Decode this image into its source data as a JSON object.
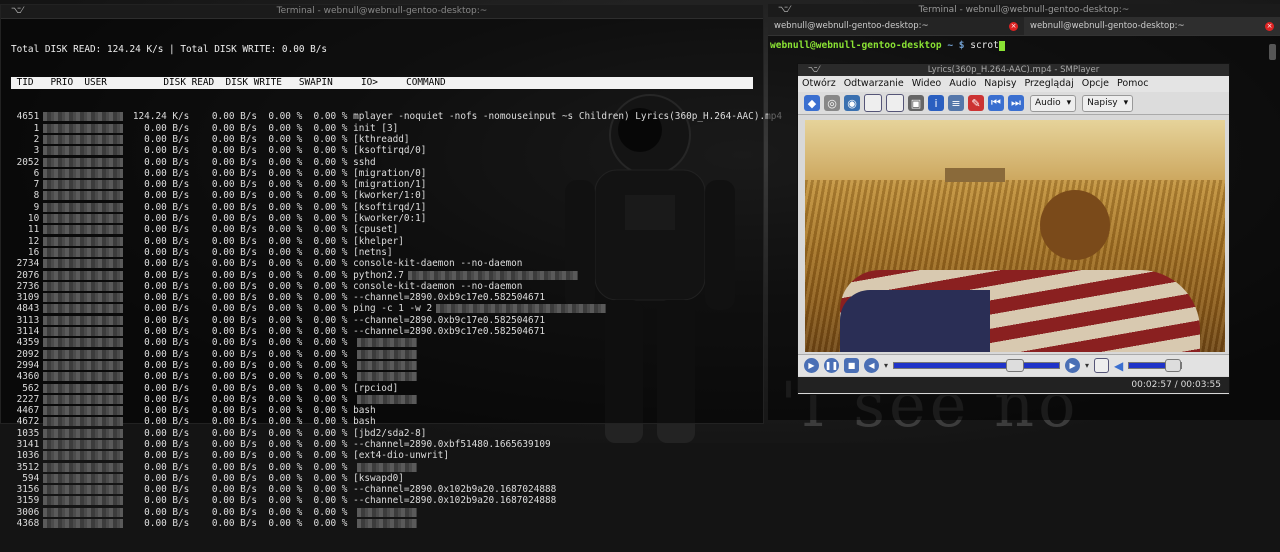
{
  "left_terminal": {
    "title": "Terminal - webnull@webnull-gentoo-desktop:~",
    "summary": "Total DISK READ: 124.24 K/s | Total DISK WRITE: 0.00 B/s",
    "columns": [
      " TID",
      "PRIO",
      "USER",
      "DISK READ",
      "DISK WRITE",
      "SWAPIN",
      "IO>",
      "COMMAND"
    ],
    "rows": [
      {
        "tid": "4651",
        "read": "124.24 K/s",
        "write": "0.00 B/s",
        "swap": "0.00 %",
        "io": "0.00 %",
        "cmd": "mplayer -noquiet -nofs -nomouseinput ~s Children) Lyrics(360p_H.264-AAC).mp4"
      },
      {
        "tid": "1",
        "read": "0.00 B/s",
        "write": "0.00 B/s",
        "swap": "0.00 %",
        "io": "0.00 %",
        "cmd": "init [3]"
      },
      {
        "tid": "2",
        "read": "0.00 B/s",
        "write": "0.00 B/s",
        "swap": "0.00 %",
        "io": "0.00 %",
        "cmd": "[kthreadd]"
      },
      {
        "tid": "3",
        "read": "0.00 B/s",
        "write": "0.00 B/s",
        "swap": "0.00 %",
        "io": "0.00 %",
        "cmd": "[ksoftirqd/0]"
      },
      {
        "tid": "2052",
        "read": "0.00 B/s",
        "write": "0.00 B/s",
        "swap": "0.00 %",
        "io": "0.00 %",
        "cmd": "sshd"
      },
      {
        "tid": "6",
        "read": "0.00 B/s",
        "write": "0.00 B/s",
        "swap": "0.00 %",
        "io": "0.00 %",
        "cmd": "[migration/0]"
      },
      {
        "tid": "7",
        "read": "0.00 B/s",
        "write": "0.00 B/s",
        "swap": "0.00 %",
        "io": "0.00 %",
        "cmd": "[migration/1]"
      },
      {
        "tid": "8",
        "read": "0.00 B/s",
        "write": "0.00 B/s",
        "swap": "0.00 %",
        "io": "0.00 %",
        "cmd": "[kworker/1:0]"
      },
      {
        "tid": "9",
        "read": "0.00 B/s",
        "write": "0.00 B/s",
        "swap": "0.00 %",
        "io": "0.00 %",
        "cmd": "[ksoftirqd/1]"
      },
      {
        "tid": "10",
        "read": "0.00 B/s",
        "write": "0.00 B/s",
        "swap": "0.00 %",
        "io": "0.00 %",
        "cmd": "[kworker/0:1]"
      },
      {
        "tid": "11",
        "read": "0.00 B/s",
        "write": "0.00 B/s",
        "swap": "0.00 %",
        "io": "0.00 %",
        "cmd": "[cpuset]"
      },
      {
        "tid": "12",
        "read": "0.00 B/s",
        "write": "0.00 B/s",
        "swap": "0.00 %",
        "io": "0.00 %",
        "cmd": "[khelper]"
      },
      {
        "tid": "16",
        "read": "0.00 B/s",
        "write": "0.00 B/s",
        "swap": "0.00 %",
        "io": "0.00 %",
        "cmd": "[netns]"
      },
      {
        "tid": "2734",
        "read": "0.00 B/s",
        "write": "0.00 B/s",
        "swap": "0.00 %",
        "io": "0.00 %",
        "cmd": "console-kit-daemon --no-daemon"
      },
      {
        "tid": "2076",
        "read": "0.00 B/s",
        "write": "0.00 B/s",
        "swap": "0.00 %",
        "io": "0.00 %",
        "cmd": "python2.7"
      },
      {
        "tid": "2736",
        "read": "0.00 B/s",
        "write": "0.00 B/s",
        "swap": "0.00 %",
        "io": "0.00 %",
        "cmd": "console-kit-daemon --no-daemon"
      },
      {
        "tid": "3109",
        "read": "0.00 B/s",
        "write": "0.00 B/s",
        "swap": "0.00 %",
        "io": "0.00 %",
        "cmd": "--channel=2890.0xb9c17e0.582504671"
      },
      {
        "tid": "4843",
        "read": "0.00 B/s",
        "write": "0.00 B/s",
        "swap": "0.00 %",
        "io": "0.00 %",
        "cmd": "ping -c 1 -w 2"
      },
      {
        "tid": "3113",
        "read": "0.00 B/s",
        "write": "0.00 B/s",
        "swap": "0.00 %",
        "io": "0.00 %",
        "cmd": "--channel=2890.0xb9c17e0.582504671"
      },
      {
        "tid": "3114",
        "read": "0.00 B/s",
        "write": "0.00 B/s",
        "swap": "0.00 %",
        "io": "0.00 %",
        "cmd": "--channel=2890.0xb9c17e0.582504671"
      },
      {
        "tid": "4359",
        "read": "0.00 B/s",
        "write": "0.00 B/s",
        "swap": "0.00 %",
        "io": "0.00 %",
        "cmd": ""
      },
      {
        "tid": "2092",
        "read": "0.00 B/s",
        "write": "0.00 B/s",
        "swap": "0.00 %",
        "io": "0.00 %",
        "cmd": ""
      },
      {
        "tid": "2994",
        "read": "0.00 B/s",
        "write": "0.00 B/s",
        "swap": "0.00 %",
        "io": "0.00 %",
        "cmd": ""
      },
      {
        "tid": "4360",
        "read": "0.00 B/s",
        "write": "0.00 B/s",
        "swap": "0.00 %",
        "io": "0.00 %",
        "cmd": ""
      },
      {
        "tid": "562",
        "read": "0.00 B/s",
        "write": "0.00 B/s",
        "swap": "0.00 %",
        "io": "0.00 %",
        "cmd": "[rpciod]"
      },
      {
        "tid": "2227",
        "read": "0.00 B/s",
        "write": "0.00 B/s",
        "swap": "0.00 %",
        "io": "0.00 %",
        "cmd": ""
      },
      {
        "tid": "4467",
        "read": "0.00 B/s",
        "write": "0.00 B/s",
        "swap": "0.00 %",
        "io": "0.00 %",
        "cmd": "bash"
      },
      {
        "tid": "4672",
        "read": "0.00 B/s",
        "write": "0.00 B/s",
        "swap": "0.00 %",
        "io": "0.00 %",
        "cmd": "bash"
      },
      {
        "tid": "1035",
        "read": "0.00 B/s",
        "write": "0.00 B/s",
        "swap": "0.00 %",
        "io": "0.00 %",
        "cmd": "[jbd2/sda2-8]"
      },
      {
        "tid": "3141",
        "read": "0.00 B/s",
        "write": "0.00 B/s",
        "swap": "0.00 %",
        "io": "0.00 %",
        "cmd": "--channel=2890.0xbf51480.1665639109"
      },
      {
        "tid": "1036",
        "read": "0.00 B/s",
        "write": "0.00 B/s",
        "swap": "0.00 %",
        "io": "0.00 %",
        "cmd": "[ext4-dio-unwrit]"
      },
      {
        "tid": "3512",
        "read": "0.00 B/s",
        "write": "0.00 B/s",
        "swap": "0.00 %",
        "io": "0.00 %",
        "cmd": ""
      },
      {
        "tid": "594",
        "read": "0.00 B/s",
        "write": "0.00 B/s",
        "swap": "0.00 %",
        "io": "0.00 %",
        "cmd": "[kswapd0]"
      },
      {
        "tid": "3156",
        "read": "0.00 B/s",
        "write": "0.00 B/s",
        "swap": "0.00 %",
        "io": "0.00 %",
        "cmd": "--channel=2890.0x102b9a20.1687024888"
      },
      {
        "tid": "3159",
        "read": "0.00 B/s",
        "write": "0.00 B/s",
        "swap": "0.00 %",
        "io": "0.00 %",
        "cmd": "--channel=2890.0x102b9a20.1687024888"
      },
      {
        "tid": "3006",
        "read": "0.00 B/s",
        "write": "0.00 B/s",
        "swap": "0.00 %",
        "io": "0.00 %",
        "cmd": ""
      },
      {
        "tid": "4368",
        "read": "0.00 B/s",
        "write": "0.00 B/s",
        "swap": "0.00 %",
        "io": "0.00 %",
        "cmd": ""
      }
    ]
  },
  "right_terminal": {
    "title": "Terminal - webnull@webnull-gentoo-desktop:~",
    "tabs": [
      {
        "label": "webnull@webnull-gentoo-desktop:~"
      },
      {
        "label": "webnull@webnull-gentoo-desktop:~"
      }
    ],
    "prompt_user": "webnull@webnull-gentoo-desktop",
    "prompt_path": "~ $",
    "command": "scrot"
  },
  "smplayer": {
    "title": "Lyrics(360p_H.264-AAC).mp4 - SMPlayer",
    "menu": [
      "Otwórz",
      "Odtwarzanie",
      "Wideo",
      "Audio",
      "Napisy",
      "Przeglądaj",
      "Opcje",
      "Pomoc"
    ],
    "audio_combo": "Audio",
    "subtitles_combo": "Napisy",
    "time": "00:02:57 / 00:03:55",
    "seek_fraction": 0.75,
    "volume_fraction": 1.0
  },
  "wallpaper_text": "'I see no"
}
